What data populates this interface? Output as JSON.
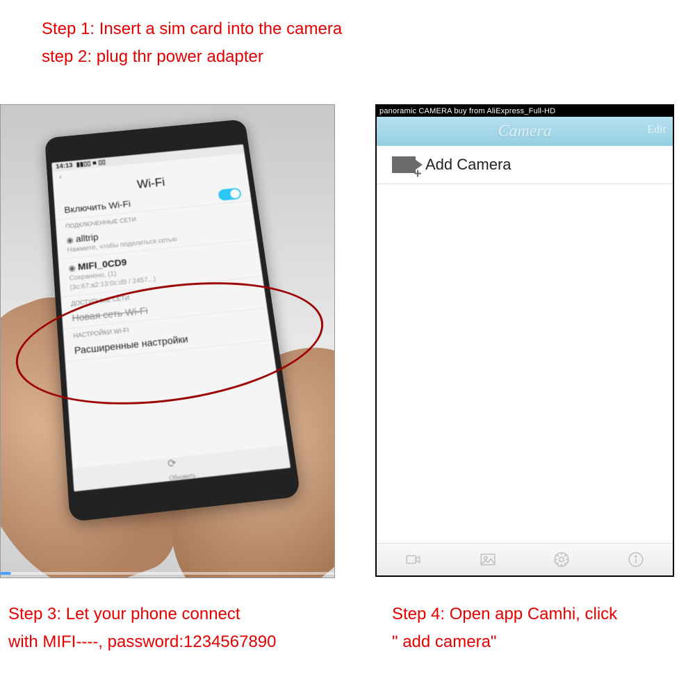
{
  "instructions": {
    "step1": "Step 1: Insert a sim card into the camera",
    "step2": "step 2: plug thr power adapter",
    "step3_line1": "Step 3: Let your phone connect",
    "step3_line2": "with MIFI----, password:1234567890",
    "step4_line1": "Step 4: Open app Camhi, click",
    "step4_line2": "\" add camera\""
  },
  "phone_screen": {
    "time": "14:13",
    "title": "Wi-Fi",
    "enable_row": "Включить Wi-Fi",
    "section_connected": "ПОДКЛЮЧЕННЫЕ СЕТИ",
    "network1": "alltrip",
    "network1_sub": "Нажмите, чтобы поделиться сетью",
    "network2": "MIFI_0CD9",
    "network2_sub": "Сохранено, (1)\n(3c:67:a2:13:0c:d9 / 2457...)",
    "section_available": "ДОСТУПНЫЕ СЕТИ",
    "row_new_network": "Новая сеть Wi-Fi",
    "section_settings": "НАСТРОЙКИ WI-FI",
    "row_advanced": "Расширенные настройки",
    "refresh_label": "Обновить"
  },
  "app": {
    "statusbar": "panoramic CAMERA buy from AliExpress_Full-HD",
    "header_title": "Camera",
    "edit": "Edit",
    "add_camera": "Add Camera"
  }
}
